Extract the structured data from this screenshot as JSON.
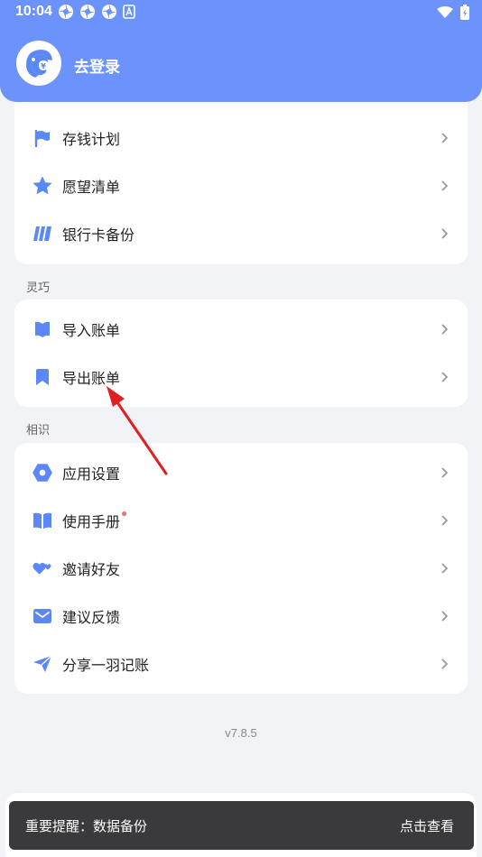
{
  "status_bar": {
    "time": "10:04"
  },
  "header": {
    "login_label": "去登录"
  },
  "menu_top": [
    {
      "label": "存钱计划",
      "icon": "flag-icon"
    },
    {
      "label": "愿望清单",
      "icon": "star-icon"
    },
    {
      "label": "银行卡备份",
      "icon": "card-stripes-icon"
    }
  ],
  "section_lingqiao": {
    "title": "灵巧"
  },
  "menu_mid": [
    {
      "label": "导入账单",
      "icon": "import-bill-icon"
    },
    {
      "label": "导出账单",
      "icon": "export-bill-icon"
    }
  ],
  "section_xiangshi": {
    "title": "相识"
  },
  "menu_bot": [
    {
      "label": "应用设置",
      "icon": "settings-icon"
    },
    {
      "label": "使用手册",
      "icon": "book-icon"
    },
    {
      "label": "邀请好友",
      "icon": "hearts-icon"
    },
    {
      "label": "建议反馈",
      "icon": "mail-icon"
    },
    {
      "label": "分享一羽记账",
      "icon": "paper-plane-icon"
    }
  ],
  "version": "v7.8.5",
  "toast": {
    "message": "重要提醒：数据备份",
    "action": "点击查看"
  },
  "colors": {
    "accent": "#6c93fb",
    "icon": "#5b87f7",
    "badge": "#f46b6b"
  }
}
